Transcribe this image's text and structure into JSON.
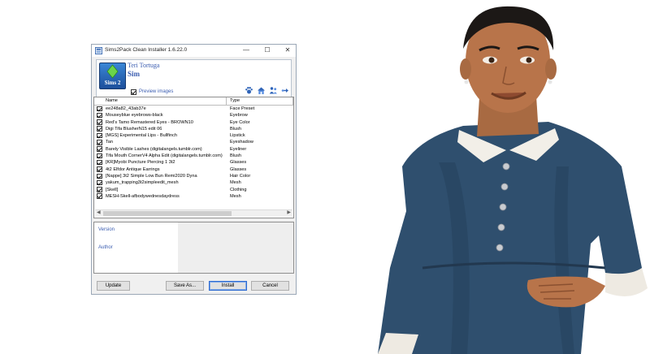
{
  "window": {
    "title": "Sims2Pack Clean Installer 1.6.22.0",
    "controls": {
      "minimize": "—",
      "maximize": "☐",
      "close": "✕"
    }
  },
  "header": {
    "author_title": "Teri Tortuga",
    "package_type": "Sim",
    "preview_label": "Preview images",
    "preview_checked": true,
    "logo_text": "Sims 2",
    "toolbar_icons": [
      "paw-icon",
      "house-icon",
      "people-icon",
      "arrow-link-icon"
    ]
  },
  "list": {
    "columns": {
      "name": "Name",
      "type": "Type"
    },
    "rows": [
      {
        "name": "ee248a82_43ab37e",
        "type": "Face Preset",
        "checked": true
      },
      {
        "name": "Mouseyblue eyebrows-black",
        "type": "Eyebrow",
        "checked": true
      },
      {
        "name": "Red's Tamo Remastered Eyes - BROWN10",
        "type": "Eye Color",
        "checked": true
      },
      {
        "name": "Digi Tifa BlusherN15 edit 06",
        "type": "Blush",
        "checked": true
      },
      {
        "name": "[MGS] Experimental Lips - Bullfinch",
        "type": "Lipstick",
        "checked": true
      },
      {
        "name": "Tan",
        "type": "Eyeshadow",
        "checked": true
      },
      {
        "name": "Barely Visible Lashes (digitalangels.tumblr.com)",
        "type": "Eyeliner",
        "checked": true
      },
      {
        "name": "Tifa Mouth CornerV4 Alpha Edit (digitalangels.tumblr.com)",
        "type": "Blush",
        "checked": true
      },
      {
        "name": "[KR]Myobi Puncture Piercing 1 3t2",
        "type": "Glasses",
        "checked": true
      },
      {
        "name": "4t2 Elfdor Antique Earrings",
        "type": "Glasses",
        "checked": true
      },
      {
        "name": "[Nappe] 3t2 Simple Low Bun Remi2020 Dyna",
        "type": "Hair Color",
        "checked": true
      },
      {
        "name": "yakum_trapping3t2simpleedit_mesh",
        "type": "Mesh",
        "checked": true
      },
      {
        "name": "[Skell]",
        "type": "Clothing",
        "checked": true
      },
      {
        "name": "MESH-Skell-afbodywednesdaydress",
        "type": "Mesh",
        "checked": true
      }
    ]
  },
  "info": {
    "version_label": "Version",
    "author_label": "Author"
  },
  "buttons": {
    "update": "Update",
    "save_as": "Save As...",
    "install": "Install",
    "cancel": "Cancel"
  },
  "colors": {
    "accent": "#3a5cb0",
    "window_bg": "#f0f0f0",
    "dress": "#2f4f6e",
    "skin": "#b8744a"
  }
}
